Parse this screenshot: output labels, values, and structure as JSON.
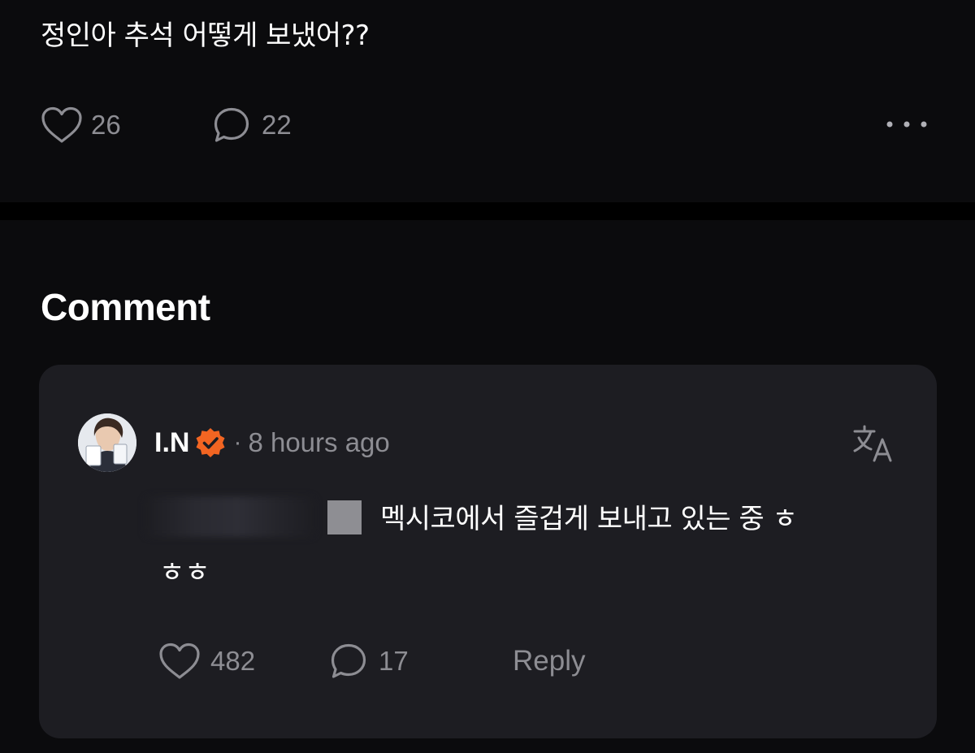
{
  "post": {
    "text": "정인아 추석 어떻게 보냈어??",
    "like_count": "26",
    "comment_count": "22",
    "more_icon": "more-horizontal-icon"
  },
  "comments_section": {
    "heading": "Comment",
    "comment": {
      "author": "I.N",
      "verified_icon": "verified-badge-icon",
      "separator": "·",
      "timestamp": "8 hours ago",
      "translate_icon": "translate-icon",
      "text_line1": "멕시코에서 즐겁게 보내고 있는 중 ㅎ",
      "text_line2": "ㅎㅎ",
      "like_count": "482",
      "reply_count": "17",
      "reply_label": "Reply"
    }
  },
  "colors": {
    "background": "#0b0b0d",
    "card": "#1d1d22",
    "muted_text": "#8d8d93",
    "verified_badge": "#f26522"
  }
}
